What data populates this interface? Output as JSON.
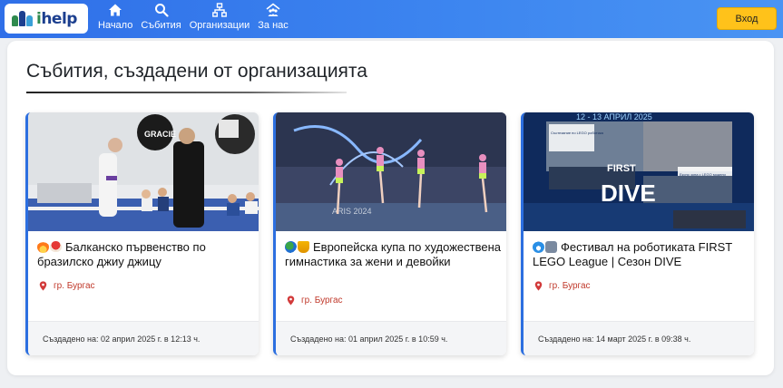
{
  "header": {
    "logo_text": "help",
    "logo_letter": "i",
    "nav": [
      {
        "label": "Начало",
        "icon": "home-icon"
      },
      {
        "label": "Събития",
        "icon": "search-icon"
      },
      {
        "label": "Организации",
        "icon": "org-chart-icon"
      },
      {
        "label": "За нас",
        "icon": "people-roof-icon"
      }
    ],
    "login_label": "Вход"
  },
  "section": {
    "title": "Събития, създадени от организацията"
  },
  "events": [
    {
      "title": "Балканско първенство по бразилско джиу джицу",
      "emojis": [
        "fire-emoji",
        "mushroom-emoji"
      ],
      "location": "гр. Бургас",
      "created": "Създадено на: 02 април 2025 г. в 12:13 ч.",
      "image_text": "GRACIE"
    },
    {
      "title": "Европейска купа по художествена гимнастика за жени и девойки",
      "emojis": [
        "globe-emoji",
        "trophy-emoji"
      ],
      "location": "гр. Бургас",
      "created": "Създадено на: 01 април 2025 г. в 10:59 ч.",
      "image_text": "ARIS 2024"
    },
    {
      "title": "Фестивал на роботиката FIRST LEGO League | Сезон DIVE",
      "emojis": [
        "wave-emoji",
        "robot-emoji"
      ],
      "location": "гр. Бургас",
      "created": "Създадено на: 14 март 2025 г. в 09:38 ч.",
      "image_text": "DIVE",
      "image_top": "12 - 13 АПРИЛ 2025",
      "image_first": "FIRST",
      "image_note1": "Състезание по LEGO роботика",
      "image_note2": "Експо зона с LEGO модели"
    }
  ],
  "colors": {
    "accent": "#2c6fe0",
    "login": "#ffc21a",
    "location": "#c0392b"
  }
}
